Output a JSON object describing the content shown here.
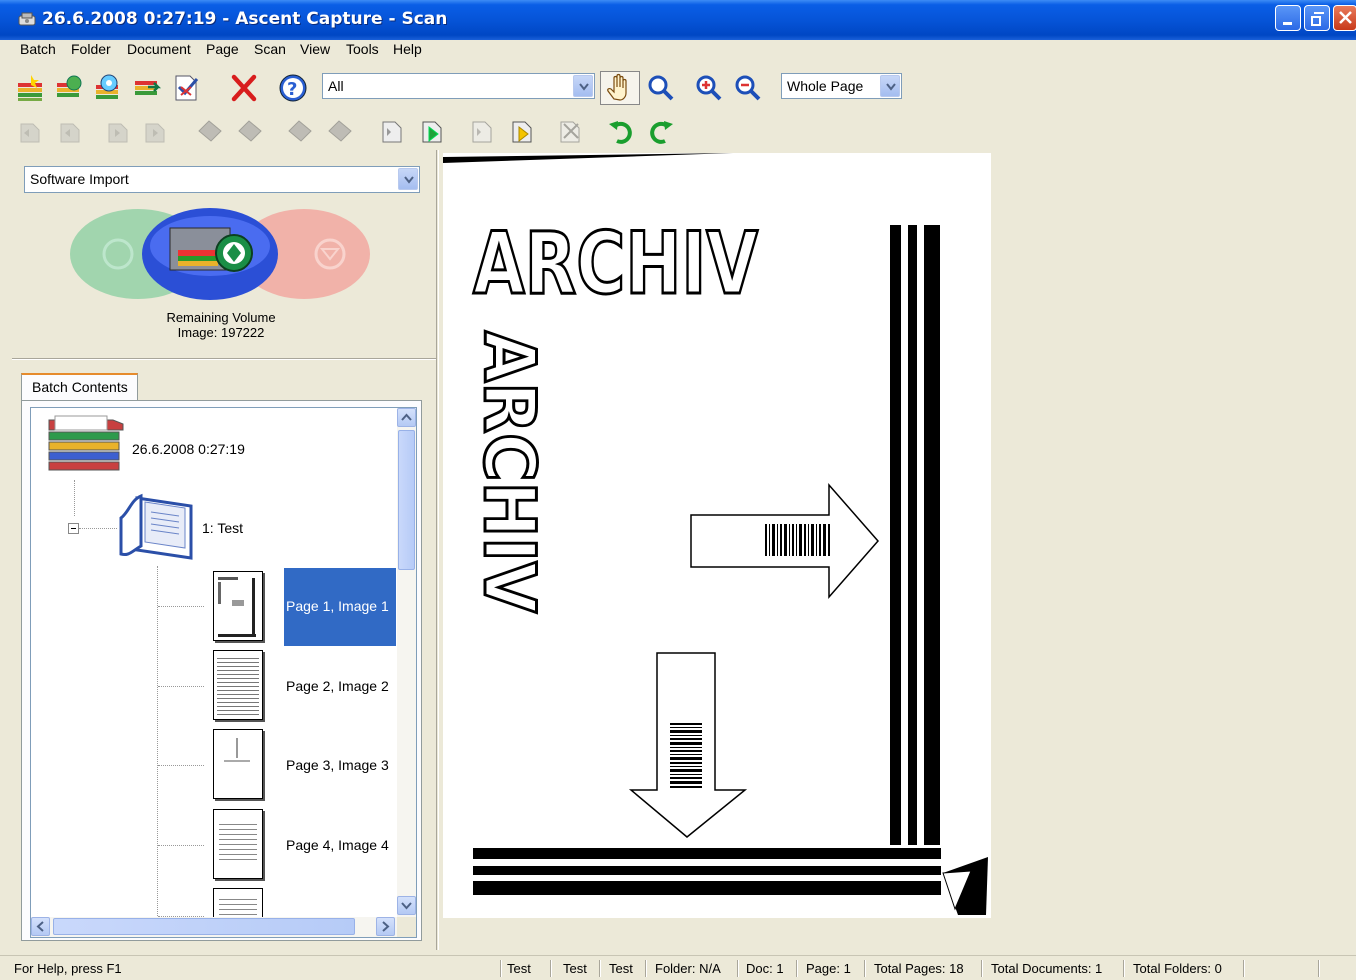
{
  "window": {
    "title": "26.6.2008 0:27:19 - Ascent Capture - Scan"
  },
  "menu": [
    "Batch",
    "Folder",
    "Document",
    "Page",
    "Scan",
    "View",
    "Tools",
    "Help"
  ],
  "toolbar": {
    "filter_combo": "All",
    "zoom_combo": "Whole Page",
    "icons_row1": [
      "new-batch-icon",
      "open-batch-icon",
      "batch-properties-icon",
      "close-batch-icon",
      "suspend-batch-icon",
      "delete-icon",
      "help-icon"
    ],
    "icons_row2": [
      "first-page-icon",
      "previous-page-icon",
      "next-page-icon",
      "last-page-icon",
      "first-document-icon",
      "previous-document-icon",
      "next-document-icon",
      "last-document-icon",
      "insert-page-icon",
      "append-page-icon",
      "replace-page-icon",
      "append-document-icon",
      "split-icon",
      "rotate-left-icon",
      "rotate-right-icon"
    ]
  },
  "left_pane": {
    "source_combo": "Software Import",
    "remaining_volume_label": "Remaining Volume",
    "remaining_volume_value": "Image: 197222",
    "tab_label": "Batch Contents"
  },
  "tree": {
    "batch_name": "26.6.2008 0:27:19",
    "document_name": "1: Test",
    "pages": [
      {
        "label": "Page 1, Image 1",
        "selected": true
      },
      {
        "label": "Page 2, Image 2",
        "selected": false
      },
      {
        "label": "Page 3, Image 3",
        "selected": false
      },
      {
        "label": "Page 4, Image 4",
        "selected": false
      }
    ]
  },
  "document": {
    "heading_horizontal": "ARCHIV",
    "heading_vertical": "ARCHIV"
  },
  "statusbar": {
    "help": "For Help, press F1",
    "cells": [
      "Test",
      "Test",
      "Test",
      "Folder: N/A",
      "Doc: 1",
      "Page: 1",
      "Total Pages: 18",
      "Total Documents: 1",
      "Total Folders: 0"
    ]
  },
  "colors": {
    "titlebar": "#0654d8",
    "selection": "#316ac5",
    "face": "#ece9d8"
  }
}
